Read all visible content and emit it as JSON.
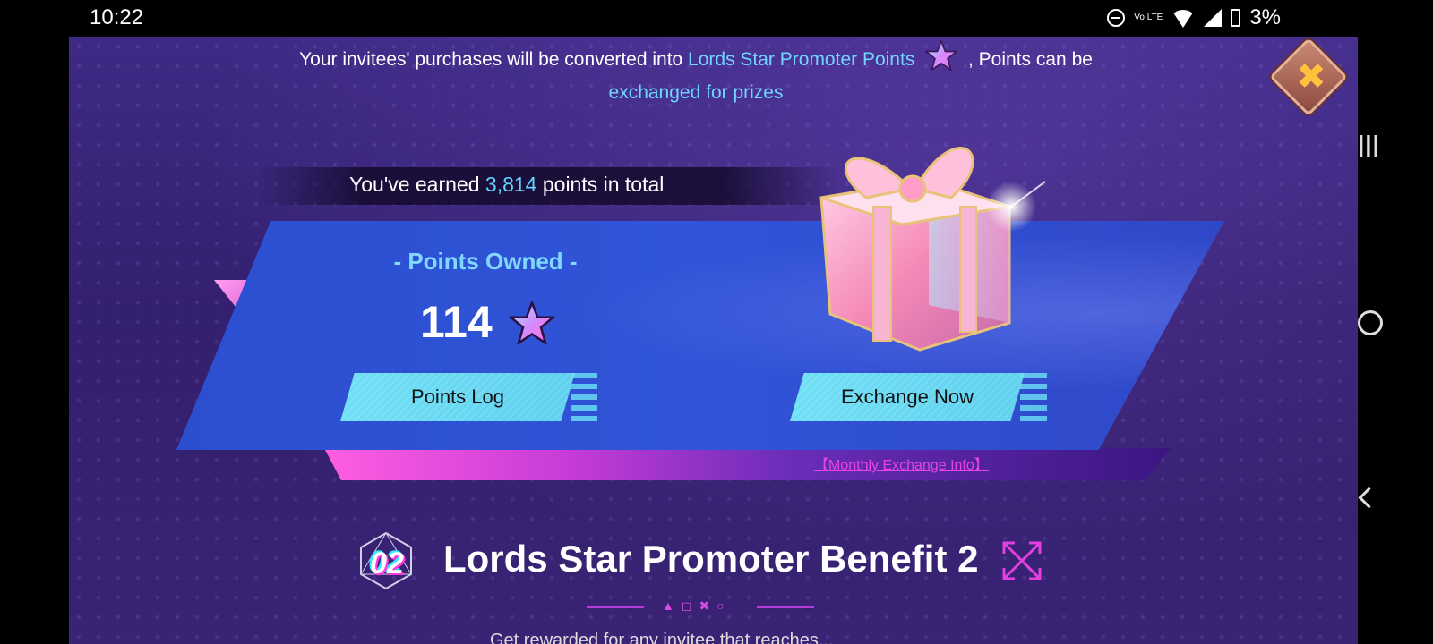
{
  "status_bar": {
    "time": "10:22",
    "network": "Vo LTE",
    "battery": "3%"
  },
  "intro": {
    "prefix": "Your invitees' purchases will be converted into ",
    "highlight": "Lords Star Promoter Points",
    "mid": " ,  Points can be",
    "line2": "exchanged for prizes"
  },
  "earned": {
    "prefix": "You've earned ",
    "value": "3,814",
    "suffix": " points in total"
  },
  "points_owned": {
    "title": "- Points Owned -",
    "value": "114"
  },
  "buttons": {
    "points_log": "Points Log",
    "exchange_now": "Exchange Now"
  },
  "monthly_exchange_info": "【Monthly Exchange Info】",
  "benefit": {
    "number": "02",
    "title": "Lords Star Promoter Benefit 2",
    "subtext": "Get rewarded for any invitee that reaches..."
  },
  "colors": {
    "accent_cyan": "#6fd7ff",
    "accent_pink": "#e544e0",
    "panel_purple": "#3e2a85",
    "banner_blue": "#3154d8"
  }
}
